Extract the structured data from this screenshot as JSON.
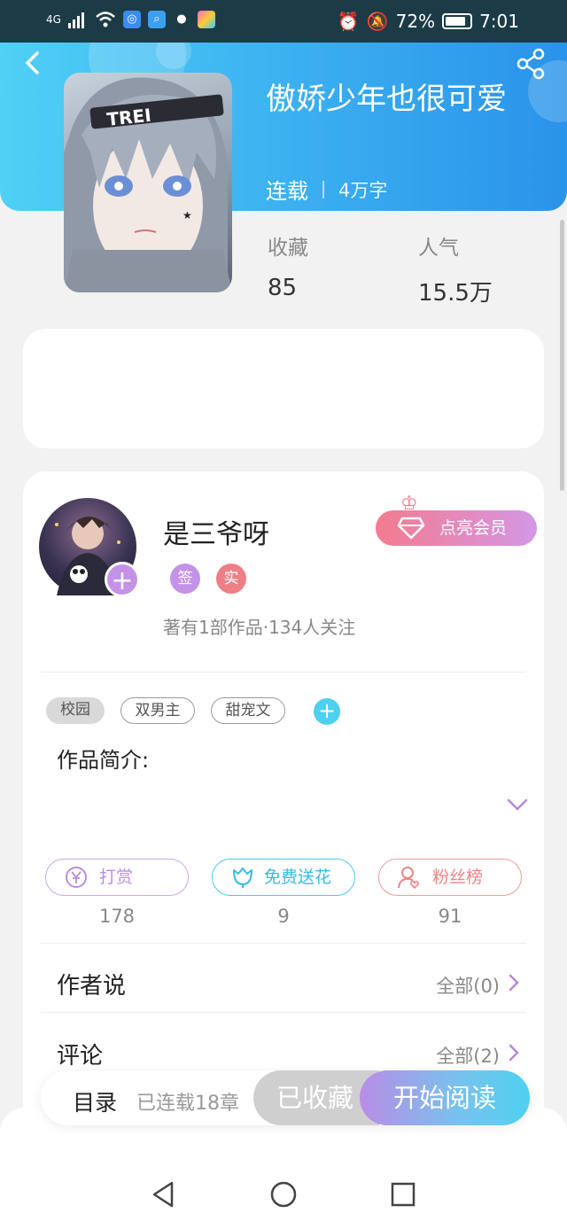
{
  "status_bar": {
    "network": "4G",
    "battery": "72%",
    "time": "7:01"
  },
  "book": {
    "title": "傲娇少年也很可爱",
    "status": "连载",
    "word_count": "4万字",
    "stats": [
      {
        "label": "收藏",
        "value": "85"
      },
      {
        "label": "人气",
        "value": "15.5万"
      }
    ]
  },
  "author": {
    "name": "是三爷呀",
    "badges": [
      "签",
      "实"
    ],
    "subtitle": "著有1部作品·134人关注",
    "vip_button": "点亮会员"
  },
  "tags": [
    "校园",
    "双男主",
    "甜宠文"
  ],
  "intro_label": "作品简介:",
  "actions": [
    {
      "label": "打赏",
      "count": "178",
      "color": "#b98de6"
    },
    {
      "label": "免费送花",
      "count": "9",
      "color": "#4fc8ec"
    },
    {
      "label": "粉丝榜",
      "count": "91",
      "color": "#ec8585"
    }
  ],
  "rows": [
    {
      "label": "作者说",
      "link": "全部(0)"
    },
    {
      "label": "评论",
      "link": "全部(2)"
    }
  ],
  "bottom_bar": {
    "toc": "目录",
    "chapters": "已连载18章",
    "collected": "已收藏",
    "read": "开始阅读"
  },
  "colors": {
    "header_start": "#4fd0f5",
    "header_end": "#2a93ea",
    "accent_purple": "#b98de6",
    "accent_cyan": "#4fd0f0"
  },
  "icons": [
    "back-arrow-icon",
    "share-icon",
    "plus-icon",
    "crown-icon",
    "diamond-icon",
    "yen-coin-icon",
    "flower-icon",
    "fan-user-icon",
    "chevron-down-icon",
    "chevron-right-icon",
    "nav-back-icon",
    "nav-home-icon",
    "nav-recents-icon"
  ]
}
